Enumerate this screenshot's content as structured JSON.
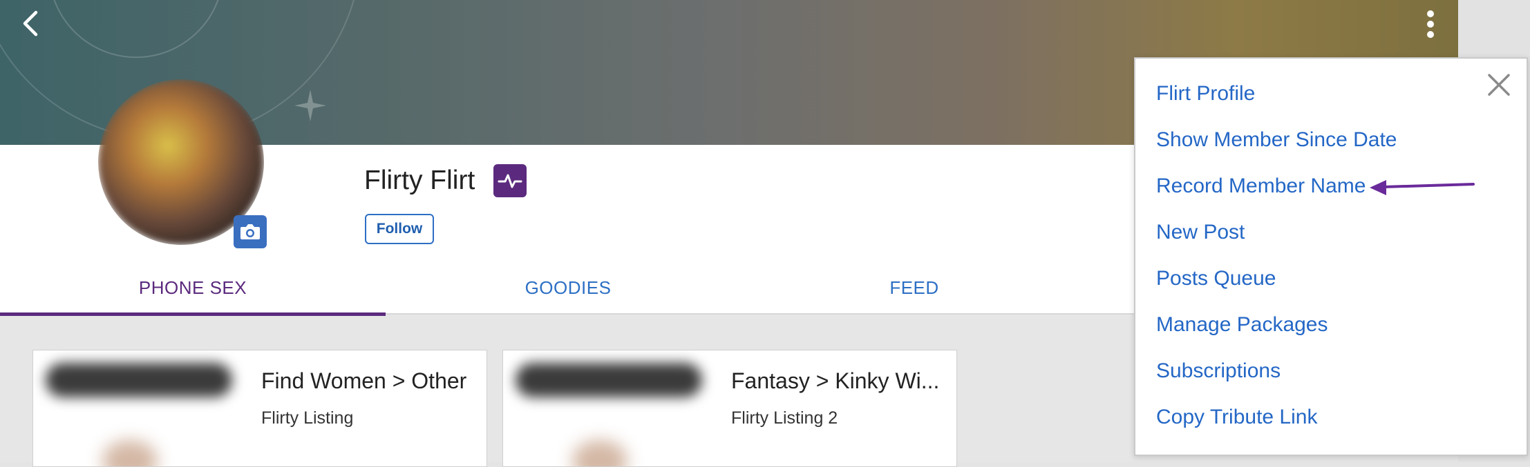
{
  "profile": {
    "name": "Flirty Flirt",
    "follow_label": "Follow"
  },
  "tabs": [
    {
      "label": "PHONE SEX",
      "active": true
    },
    {
      "label": "GOODIES",
      "active": false
    },
    {
      "label": "FEED",
      "active": false
    }
  ],
  "listings": [
    {
      "title": "Find Women > Other",
      "subtitle": "Flirty Listing"
    },
    {
      "title": "Fantasy > Kinky Wi...",
      "subtitle": "Flirty Listing 2"
    }
  ],
  "menu": {
    "items": [
      {
        "label": "Flirt Profile"
      },
      {
        "label": "Show Member Since Date"
      },
      {
        "label": "Record Member Name"
      },
      {
        "label": "New Post"
      },
      {
        "label": "Posts Queue"
      },
      {
        "label": "Manage Packages"
      },
      {
        "label": "Subscriptions"
      },
      {
        "label": "Copy Tribute Link"
      }
    ],
    "highlighted_item": "Record Member Name"
  },
  "icons": {
    "back": "chevron-left-icon",
    "more": "more-vertical-icon",
    "camera": "camera-icon",
    "badge": "pulse-icon",
    "close": "close-icon",
    "annotation": "arrow-left-icon"
  },
  "colors": {
    "accent_purple": "#5b2a7e",
    "link_blue": "#2467c6",
    "annotation_arrow": "#6a2a9a"
  }
}
